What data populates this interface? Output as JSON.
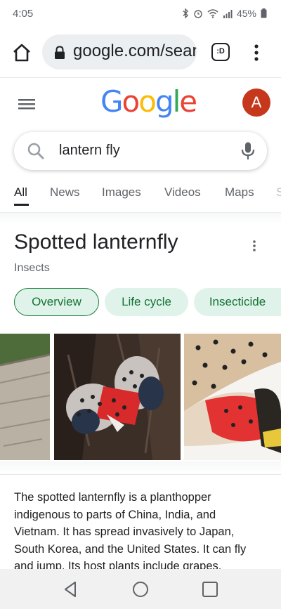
{
  "status_bar": {
    "time": "4:05",
    "battery": "45%",
    "icons": [
      "bluetooth-icon",
      "alarm-icon",
      "wifi-icon",
      "signal-icon",
      "battery-icon"
    ]
  },
  "browser": {
    "url": "google.com/sear",
    "tab_switcher_label": ":D",
    "icons": [
      "home-icon",
      "lock-icon",
      "more-vert-icon"
    ]
  },
  "google_header": {
    "logo_letters": [
      "G",
      "o",
      "o",
      "g",
      "l",
      "e"
    ],
    "logo_colors": [
      "#4285F4",
      "#EA4335",
      "#FBBC05",
      "#4285F4",
      "#34A853",
      "#EA4335"
    ],
    "avatar_letter": "A",
    "avatar_color": "#c5381c"
  },
  "search": {
    "query": "lantern fly"
  },
  "tabs": [
    {
      "label": "All",
      "active": true
    },
    {
      "label": "News",
      "active": false
    },
    {
      "label": "Images",
      "active": false
    },
    {
      "label": "Videos",
      "active": false
    },
    {
      "label": "Maps",
      "active": false
    },
    {
      "label": "S",
      "active": false
    }
  ],
  "knowledge_panel": {
    "title": "Spotted lanternfly",
    "subtitle": "Insects",
    "chips": [
      {
        "label": "Overview",
        "selected": true
      },
      {
        "label": "Life cycle",
        "selected": false
      },
      {
        "label": "Insecticide",
        "selected": false
      }
    ],
    "description": "The spotted lanternfly is a planthopper indigenous to parts of China, India, and Vietnam. It has spread invasively to Japan, South Korea, and the United States. It can fly and jump. Its host plants include grapes,"
  },
  "colors": {
    "chip_bg": "#dff3ea",
    "chip_text": "#137333",
    "accent_red": "#d82a2a"
  }
}
